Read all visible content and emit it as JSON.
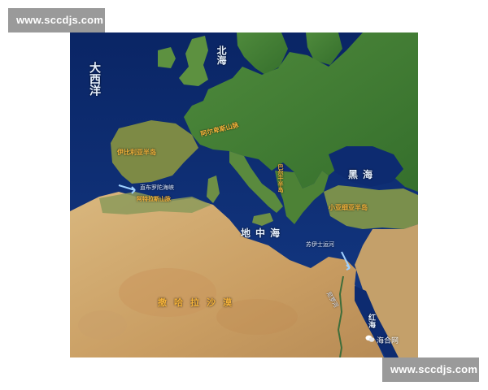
{
  "watermark": {
    "text": "www.sccdjs.com"
  },
  "map": {
    "credit": "海合网",
    "seas": {
      "atlantic": "大西洋",
      "north_sea": "北海",
      "black_sea": "黑海",
      "mediterranean": "地中海",
      "red_sea": "红海"
    },
    "regions": {
      "alps": "阿尔卑斯山脉",
      "iberia": "伊比利亚半岛",
      "apennine": "亚平宁半岛",
      "balkan": "巴尔干半岛",
      "asia_minor": "小亚细亚半岛",
      "atlas": "阿特拉斯山脉",
      "sahara": "撒哈拉沙漠"
    },
    "features": {
      "gibraltar": "直布罗陀海峡",
      "suez": "苏伊士运河",
      "nile": "尼罗河"
    },
    "colors": {
      "sea": "#0c2a6e",
      "land_green": "#3f7a33",
      "desert": "#d3ae74",
      "label_orange": "#f5b33b"
    }
  }
}
